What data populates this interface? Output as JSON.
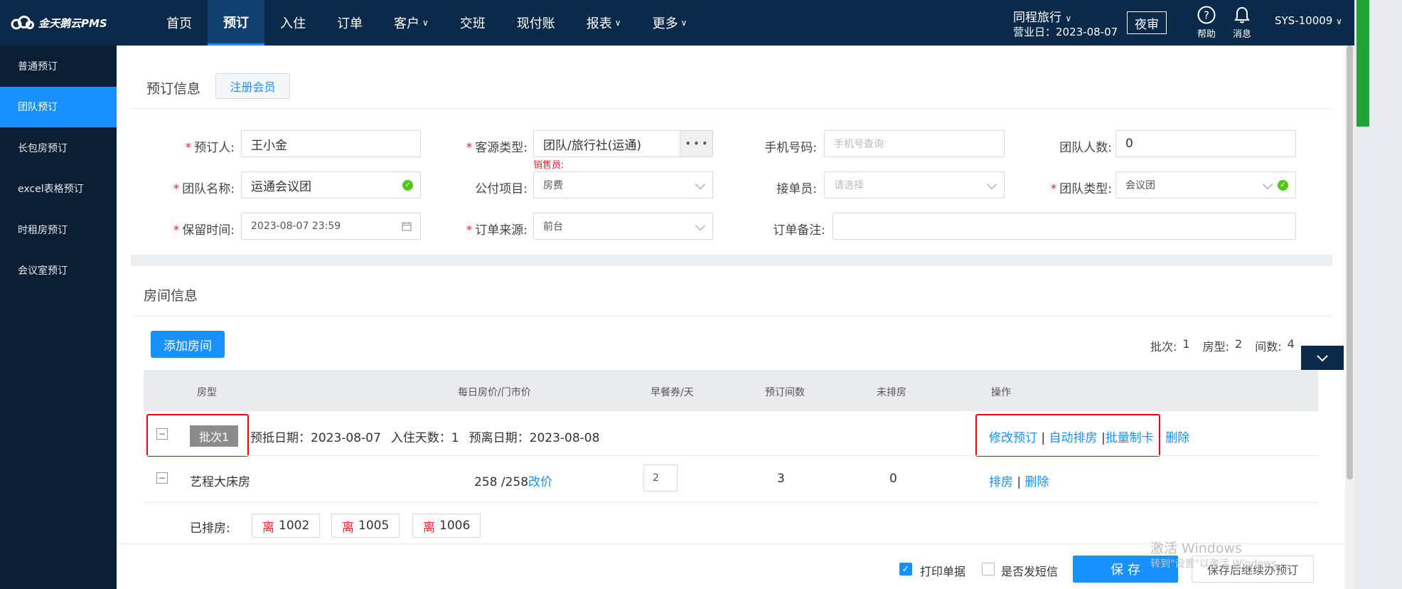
{
  "app": {
    "logo_text": "金天鹅云PMS"
  },
  "nav": [
    {
      "label": "首页",
      "has_dropdown": false,
      "active": false
    },
    {
      "label": "预订",
      "has_dropdown": false,
      "active": true
    },
    {
      "label": "入住",
      "has_dropdown": false,
      "active": false
    },
    {
      "label": "订单",
      "has_dropdown": false,
      "active": false
    },
    {
      "label": "客户",
      "has_dropdown": true,
      "active": false
    },
    {
      "label": "交班",
      "has_dropdown": false,
      "active": false
    },
    {
      "label": "现付账",
      "has_dropdown": false,
      "active": false
    },
    {
      "label": "报表",
      "has_dropdown": true,
      "active": false
    },
    {
      "label": "更多",
      "has_dropdown": true,
      "active": false
    }
  ],
  "header": {
    "hotel_name": "同程旅行",
    "business_date": "营业日：2023-08-07",
    "night_audit": "夜审",
    "help": "帮助",
    "messages": "消息",
    "user": "SYS-10009"
  },
  "sidebar": {
    "items": [
      {
        "label": "普通预订",
        "active": false
      },
      {
        "label": "团队预订",
        "active": true
      },
      {
        "label": "长包房预订",
        "active": false
      },
      {
        "label": "excel表格预订",
        "active": false
      },
      {
        "label": "时租房预订",
        "active": false
      },
      {
        "label": "会议室预订",
        "active": false
      }
    ]
  },
  "booking_info": {
    "title": "预订信息",
    "register_member": "注册会员",
    "booker_label": "预订人:",
    "booker_value": "王小金",
    "source_type_label": "客源类型:",
    "source_type_value": "团队/旅行社(运通)",
    "source_more": "• • •",
    "salesperson": "销售员:",
    "phone_label": "手机号码:",
    "phone_placeholder": "手机号查询",
    "group_size_label": "团队人数:",
    "group_size_value": "0",
    "group_name_label": "团队名称:",
    "group_name_value": "运通会议团",
    "billing_item_label": "公付项目:",
    "billing_item_value": "房费",
    "receiver_label": "接单员:",
    "receiver_placeholder": "请选择",
    "group_type_label": "团队类型:",
    "group_type_value": "会议团",
    "hold_time_label": "保留时间:",
    "hold_time_value": "2023-08-07 23:59",
    "order_source_label": "订单来源:",
    "order_source_value": "前台",
    "remark_label": "订单备注:",
    "remark_value": ""
  },
  "room_info": {
    "title": "房间信息",
    "add_room": "添加房间",
    "summary_batches_label": "批次:",
    "summary_batches": "1",
    "summary_types_label": "房型:",
    "summary_types": "2",
    "summary_rooms_label": "间数:",
    "summary_rooms": "4",
    "columns": [
      "房型",
      "每日房价/门市价",
      "早餐券/天",
      "预订间数",
      "未排房",
      "操作"
    ],
    "batch": {
      "tag": "批次1",
      "arrival": "预抵日期：2023-08-07",
      "nights": "入住天数：1",
      "departure": "预离日期：2023-08-08",
      "actions": [
        "修改预订",
        "自动排房",
        "批量制卡",
        "删除"
      ]
    },
    "rows": [
      {
        "room_type": "艺程大床房",
        "price": "258 /258",
        "change_price": "改价",
        "breakfast": "2",
        "booked": "3",
        "unassigned": "0",
        "actions": [
          "排房",
          "删除"
        ]
      }
    ],
    "assigned_label": "已排房:",
    "assigned_rooms": [
      {
        "status": "离",
        "number": "1002"
      },
      {
        "status": "离",
        "number": "1005"
      },
      {
        "status": "离",
        "number": "1006"
      }
    ]
  },
  "footer": {
    "print_receipt": "打印单据",
    "print_checked": true,
    "send_sms": "是否发短信",
    "sms_checked": false,
    "save": "保 存",
    "save_continue": "保存后继续办预订"
  },
  "watermark": {
    "line1": "激活 Windows",
    "line2": "转到\"设置\"以激活 Windows。"
  },
  "colors": {
    "topbar": "#0b2a4a",
    "sidebar": "#0b1d33",
    "accent": "#1890ff",
    "required": "#f5222d",
    "highlight_frame": "#ff0000"
  }
}
